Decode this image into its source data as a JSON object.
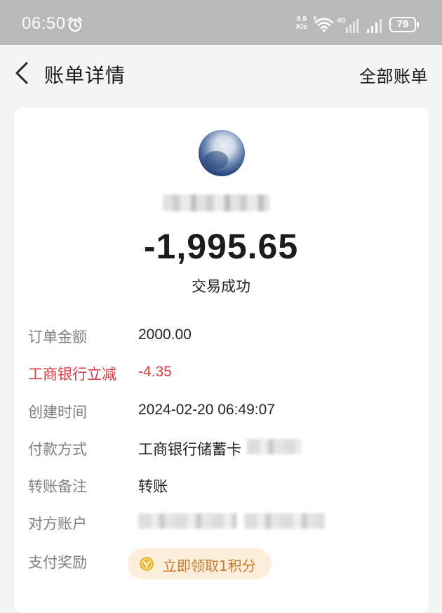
{
  "status_bar": {
    "time": "06:50",
    "net_speed_value": "9.9",
    "net_speed_unit": "K/s",
    "wifi_badge": "6",
    "network_type": "4G",
    "battery": "79",
    "icons": [
      "alarm-icon",
      "wifi-icon",
      "signal-icon",
      "signal-icon",
      "battery-icon"
    ]
  },
  "nav": {
    "title": "账单详情",
    "action": "全部账单"
  },
  "bill": {
    "amount": "-1,995.65",
    "status": "交易成功",
    "rows": [
      {
        "label": "订单金额",
        "value": "2000.00"
      },
      {
        "label": "工商银行立减",
        "value": "-4.35"
      },
      {
        "label": "创建时间",
        "value": "2024-02-20 06:49:07"
      },
      {
        "label": "付款方式",
        "value": "工商银行储蓄卡"
      },
      {
        "label": "转账备注",
        "value": "转账"
      },
      {
        "label": "对方账户",
        "value": ""
      },
      {
        "label": "支付奖励",
        "value": ""
      }
    ],
    "reward_button": "立即领取1积分"
  },
  "colors": {
    "discount_red": "#d93a44",
    "reward_bg": "#fdeedb",
    "reward_text": "#c9782c",
    "coin": "#e8b63a"
  }
}
